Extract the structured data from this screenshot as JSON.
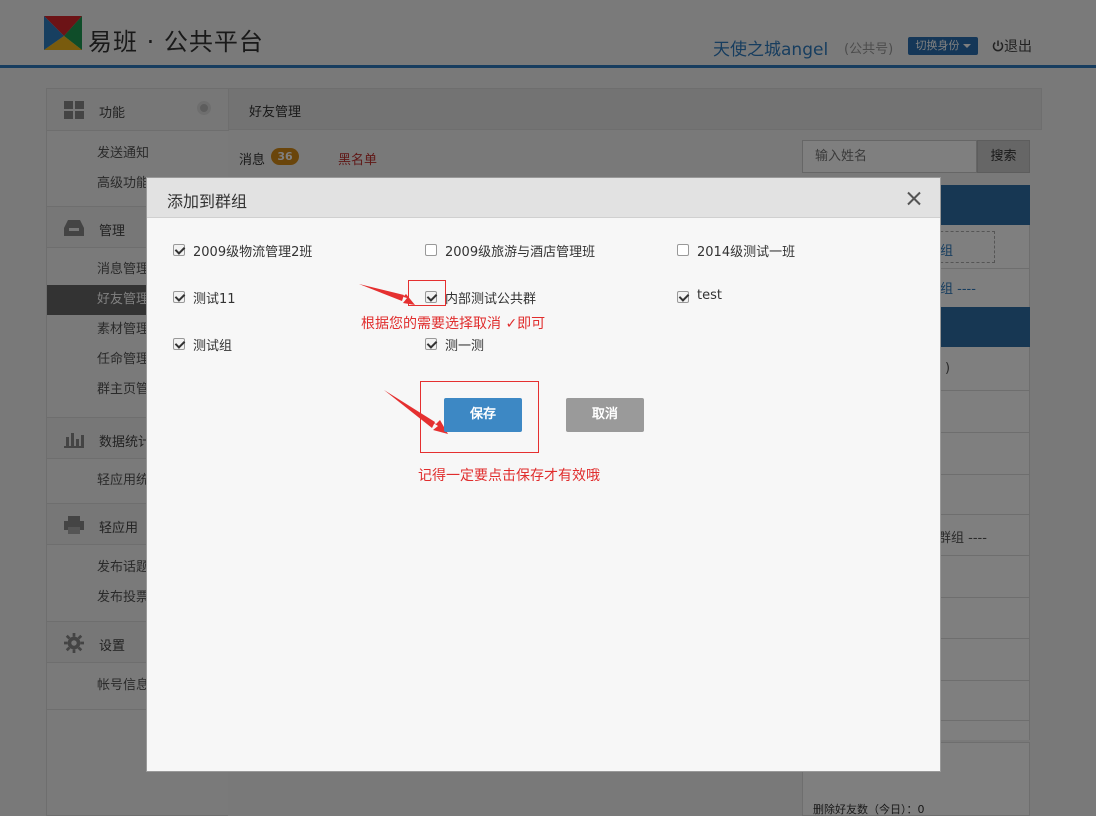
{
  "header": {
    "brand": "易班 · 公共平台",
    "user_name": "天使之城angel",
    "user_type": "(公共号)",
    "switch_label": "切换身份",
    "logout_label": "退出",
    "accent_color": "#2e7bbf"
  },
  "sidebar": {
    "sections": [
      {
        "title": "功能",
        "icon": "grid-icon",
        "items": [
          "发送通知",
          "高级功能"
        ]
      },
      {
        "title": "管理",
        "icon": "inbox-icon",
        "items": [
          "消息管理",
          "好友管理",
          "素材管理",
          "任命管理",
          "群主页管"
        ]
      },
      {
        "title": "数据统计",
        "icon": "bar-chart-icon",
        "items": [
          "轻应用统"
        ]
      },
      {
        "title": "轻应用",
        "icon": "printer-icon",
        "items": [
          "发布话题",
          "发布投票"
        ]
      },
      {
        "title": "设置",
        "icon": "gear-icon",
        "items": [
          "帐号信息"
        ]
      }
    ],
    "active_item": "好友管理"
  },
  "main": {
    "title": "好友管理",
    "tab_message": "消息",
    "message_count": "36",
    "tab_blacklist": "黑名单",
    "search_placeholder": "输入姓名",
    "search_button": "搜索",
    "right_fragments": {
      "f1": "组",
      "f2": "组  ----",
      "f3": ")",
      "f4": "群组  ----"
    },
    "stat_text": "删除好友数（今日）：0"
  },
  "modal": {
    "title": "添加到群组",
    "groups": [
      {
        "label": "2009级物流管理2班",
        "checked": true
      },
      {
        "label": "2009级旅游与酒店管理班",
        "checked": false
      },
      {
        "label": "2014级测试一班",
        "checked": false
      },
      {
        "label": "测试11",
        "checked": true
      },
      {
        "label": "内部测试公共群",
        "checked": true
      },
      {
        "label": "test",
        "checked": true
      },
      {
        "label": "测试组",
        "checked": true
      },
      {
        "label": "测一测",
        "checked": true
      }
    ],
    "save_label": "保存",
    "cancel_label": "取消"
  },
  "annotations": {
    "note_select": "根据您的需要选择取消 ✓即可",
    "note_save": "记得一定要点击保存才有效哦",
    "color": "#e02d2d"
  }
}
